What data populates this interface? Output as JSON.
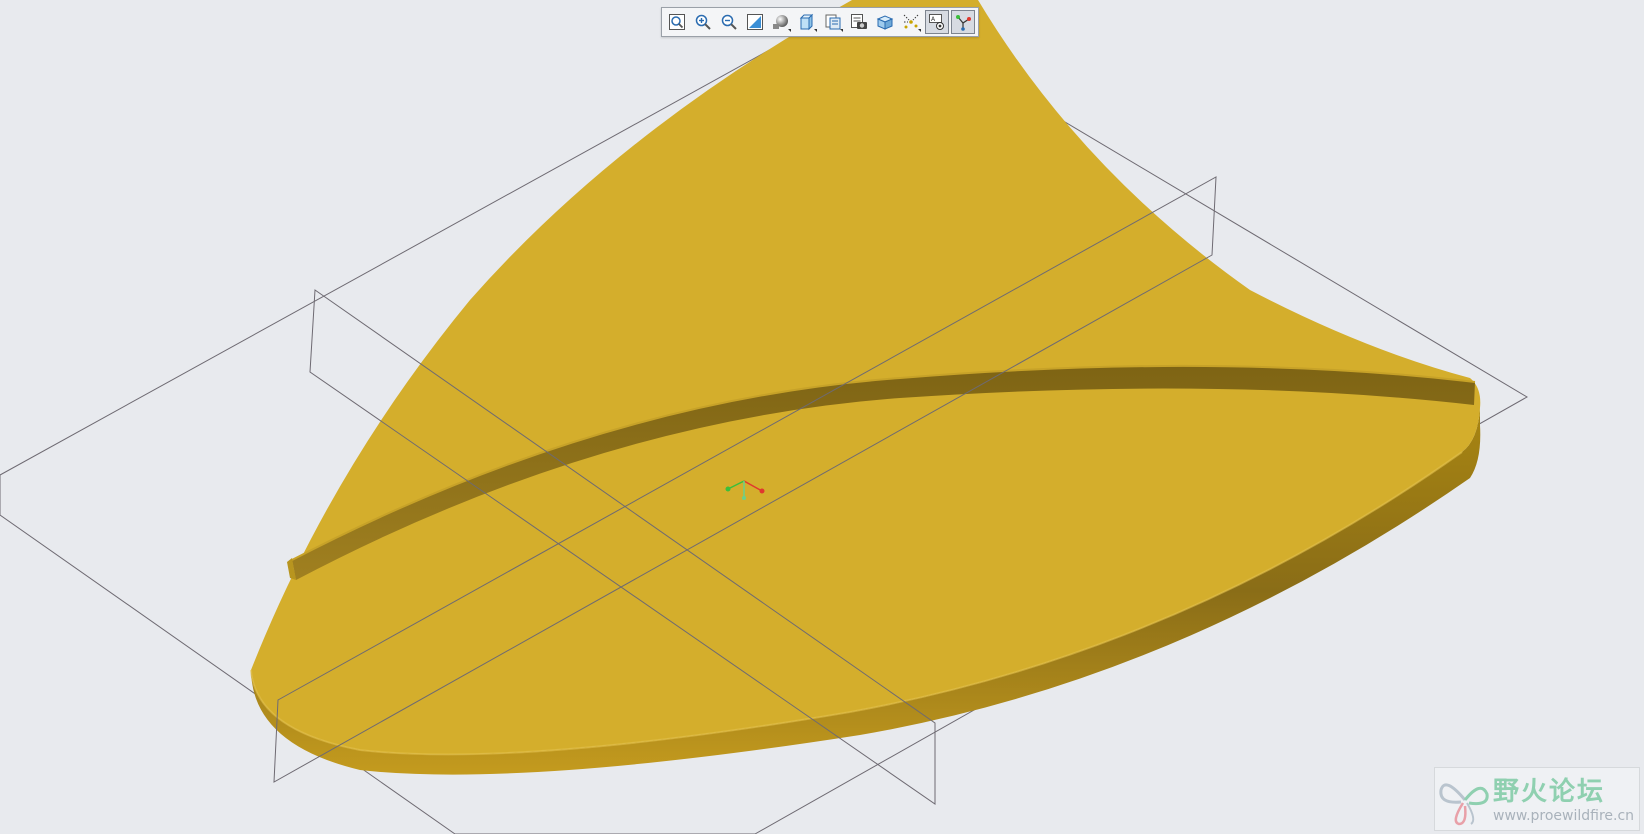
{
  "toolbar": {
    "buttons": [
      {
        "name": "refit",
        "icon": "refit-zoom-icon",
        "active": false
      },
      {
        "name": "zoom-in",
        "icon": "zoom-in-icon",
        "active": false
      },
      {
        "name": "zoom-out",
        "icon": "zoom-out-icon",
        "active": false
      },
      {
        "name": "repaint",
        "icon": "repaint-icon",
        "active": false
      },
      {
        "name": "display-style",
        "icon": "shaded-sphere-icon",
        "active": false,
        "dropdown": true
      },
      {
        "name": "saved-orientations",
        "icon": "cube-view-icon",
        "active": false,
        "dropdown": true
      },
      {
        "name": "named-views",
        "icon": "named-views-icon",
        "active": false,
        "dropdown": true
      },
      {
        "name": "view-manager",
        "icon": "view-manager-icon",
        "active": false
      },
      {
        "name": "perspective",
        "icon": "perspective-cube-icon",
        "active": false
      },
      {
        "name": "datum-display",
        "icon": "datum-display-icon",
        "active": false,
        "dropdown": true
      },
      {
        "name": "annotation-display",
        "icon": "annotation-display-icon",
        "active": true
      },
      {
        "name": "spin-center",
        "icon": "spin-center-icon",
        "active": true
      }
    ]
  },
  "watermark": {
    "title": "野火论坛",
    "url": "www.proewildfire.cn"
  },
  "colors": {
    "background": "#e8eaee",
    "part": "#d4ae2c",
    "part_shadow": "#8a6d17",
    "datum_plane": "#6e6a72",
    "csys_x": "#e0382e",
    "csys_y": "#3bbf3b",
    "csys_z": "#6bd08a"
  }
}
